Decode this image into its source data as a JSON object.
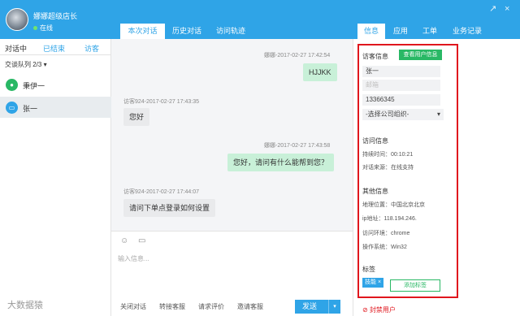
{
  "window": {
    "username": "娜娜超级店长",
    "status": "在线",
    "controls": [
      "↗",
      "×"
    ]
  },
  "center_tabs": [
    "本次对话",
    "历史对话",
    "访问轨迹"
  ],
  "right_tabs": [
    "信息",
    "应用",
    "工单",
    "业务记录"
  ],
  "left": {
    "tabs": [
      "对话中",
      "已结束",
      "访客"
    ],
    "queue_label": "交谈队列 2/3 ▾",
    "contacts": [
      {
        "name": "秉伊一",
        "icon": "wechat-icon",
        "color": "#29b865"
      },
      {
        "name": "张一",
        "icon": "monitor-icon",
        "color": "#2fa4e7"
      }
    ]
  },
  "chat": {
    "messages": [
      {
        "timestamp": "娜娜-2017-02-27 17:42:54",
        "text": "HJJKK",
        "dir": "out"
      },
      {
        "timestamp": "访客924-2017-02-27 17:43:35",
        "text": "您好",
        "dir": "in"
      },
      {
        "timestamp": "娜娜-2017-02-27 17:43:58",
        "text": "您好，请问有什么能帮到您？",
        "dir": "out"
      },
      {
        "timestamp": "访客924-2017-02-27 17:44:07",
        "text": "请问下单点登录如何设置",
        "dir": "in"
      }
    ],
    "input_placeholder": "输入信息...",
    "actions": [
      "关闭对话",
      "转接客服",
      "请求评价",
      "邀请客服"
    ],
    "send_label": "发送",
    "send_arrow": "▾"
  },
  "info_panel": {
    "visitor_title": "访客信息",
    "view_user_button": "查看用户信息",
    "name_value": "张一",
    "field_blur": "邮箱",
    "phone_value": "13366345",
    "org_select": "-选择公司组织-",
    "visit_title": "访问信息",
    "duration": "持续时间：00:10:21",
    "source": "对话来源：在线支持",
    "other_title": "其他信息",
    "location": "地理位置：中国北京北京",
    "ip": "ip地址：118.194.246.",
    "env": "访问环境：chrome",
    "os": "操作系统：Win32",
    "tags_title": "标签",
    "tag": "技能 ×",
    "add_tag_button": "添加标签",
    "block_user": "⊘ 封禁用户"
  },
  "watermark": "大数据猿"
}
